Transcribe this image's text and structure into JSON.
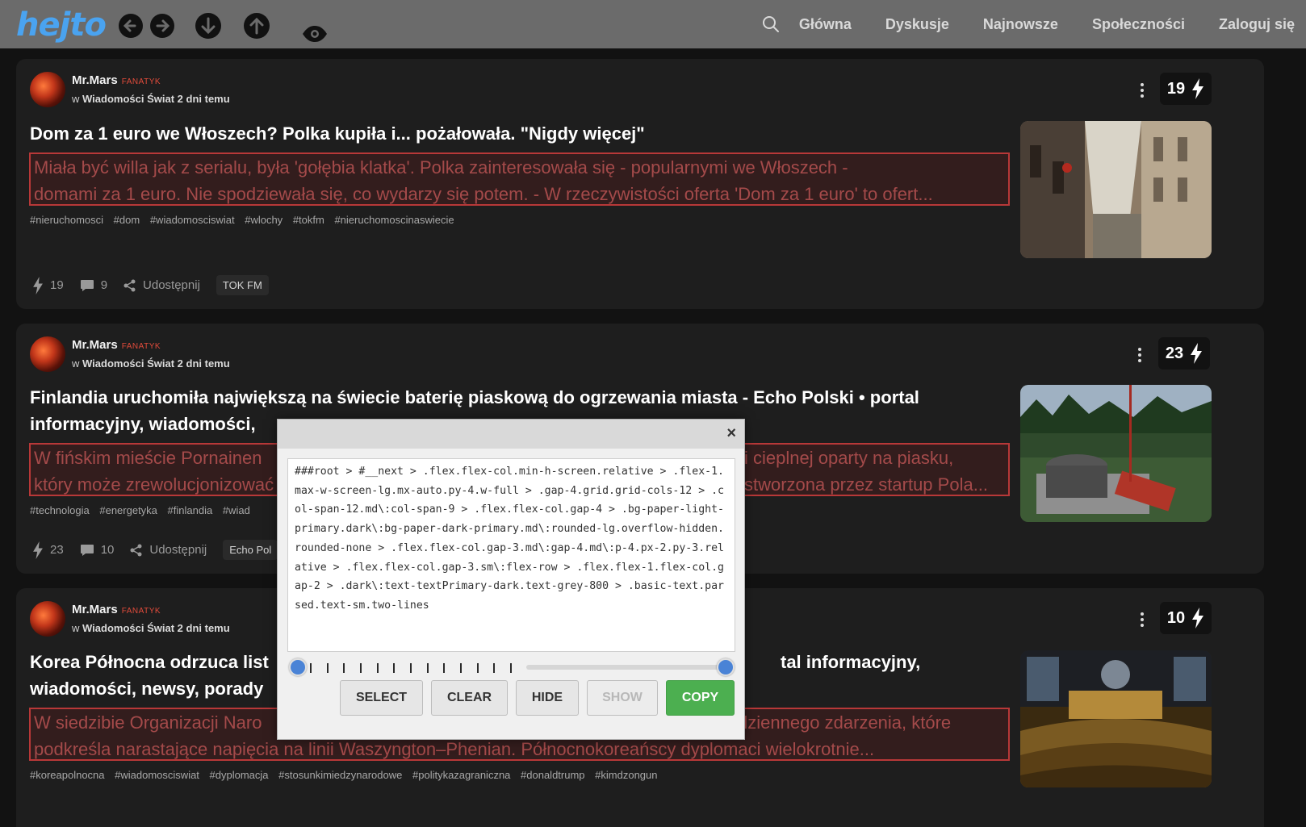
{
  "topbar": {
    "logo": "hejto",
    "nav": [
      "Główna",
      "Dyskusje",
      "Najnowsze",
      "Społeczności",
      "Zaloguj się"
    ]
  },
  "posts": [
    {
      "author": "Mr.Mars",
      "badge": "FANATYK",
      "meta_prefix": "w",
      "community": "Wiadomości Świat",
      "time": "2 dni temu",
      "votes": "19",
      "title": "Dom za 1 euro we Włoszech? Polka kupiła i... pożałowała. \"Nigdy więcej\"",
      "excerpt_lines": [
        "Miała być willa jak z serialu, była 'gołębia klatka'. Polka zainteresowała się - popularnymi we Włoszech -",
        "domami za 1 euro. Nie spodziewała się, co wydarzy się potem. - W rzeczywistości oferta 'Dom za 1 euro' to ofert..."
      ],
      "tags": [
        "#nieruchomosci",
        "#dom",
        "#wiadomosciswiat",
        "#wlochy",
        "#tokfm",
        "#nieruchomoscinaswiecie"
      ],
      "likes": "19",
      "comments": "9",
      "share": "Udostępnij",
      "source": "TOK FM"
    },
    {
      "author": "Mr.Mars",
      "badge": "FANATYK",
      "meta_prefix": "w",
      "community": "Wiadomości Świat",
      "time": "2 dni temu",
      "votes": "23",
      "title_line1": "Finlandia uruchomiła największą na świecie baterię piaskową do ogrzewania miasta - Echo Polski • portal",
      "title_line2": "informacyjny, wiadomości,",
      "excerpt_left": [
        "W fińskim mieście Pornainen",
        "który może zrewolucjonizować"
      ],
      "excerpt_right": [
        "i cieplnej oparty na piasku,",
        "stworzona przez startup Pola..."
      ],
      "tags": [
        "#technologia",
        "#energetyka",
        "#finlandia",
        "#wiad"
      ],
      "likes": "23",
      "comments": "10",
      "share": "Udostępnij",
      "source": "Echo Pol"
    },
    {
      "author": "Mr.Mars",
      "badge": "FANATYK",
      "meta_prefix": "w",
      "community": "Wiadomości Świat",
      "time": "2 dni temu",
      "votes": "10",
      "title_left_1": "Korea Północna odrzuca list",
      "title_right_1": "tal informacyjny,",
      "title_left_2": "wiadomości, newsy, porady",
      "excerpt_left": [
        "W siedzibie Organizacji Naro",
        "podkreśla narastające napięcia na linii Waszyngton–Phenian. Północnokoreańscy dyplomaci wielokrotnie..."
      ],
      "excerpt_right": [
        "dziennego zdarzenia, które"
      ],
      "tags": [
        "#koreapolnocna",
        "#wiadomosciswiat",
        "#dyplomacja",
        "#stosunkimiedzynarodowe",
        "#politykazagraniczna",
        "#donaldtrump",
        "#kimdzongun"
      ]
    }
  ],
  "modal": {
    "selector_text": "###root > #__next > .flex.flex-col.min-h-screen.relative > .flex-1.max-w-screen-lg.mx-auto.py-4.w-full > .gap-4.grid.grid-cols-12 > .col-span-12.md\\:col-span-9 > .flex.flex-col.gap-4 > .bg-paper-light-primary.dark\\:bg-paper-dark-primary.md\\:rounded-lg.overflow-hidden.rounded-none > .flex.flex-col.gap-3.md\\:gap-4.md\\:p-4.px-2.py-3.relative > .flex.flex-col.gap-3.sm\\:flex-row > .flex.flex-1.flex-col.gap-2 > .dark\\:text-textPrimary-dark.text-grey-800 > .basic-text.parsed.text-sm.two-lines",
    "close": "×",
    "buttons": [
      "SELECT",
      "CLEAR",
      "HIDE",
      "SHOW",
      "COPY"
    ]
  },
  "colors": {
    "topbar": "#6b6b6b",
    "logo": "#4aa3f0",
    "card": "#1e1e1e",
    "highlight_border": "#b83838",
    "copy_button": "#4caf50"
  }
}
